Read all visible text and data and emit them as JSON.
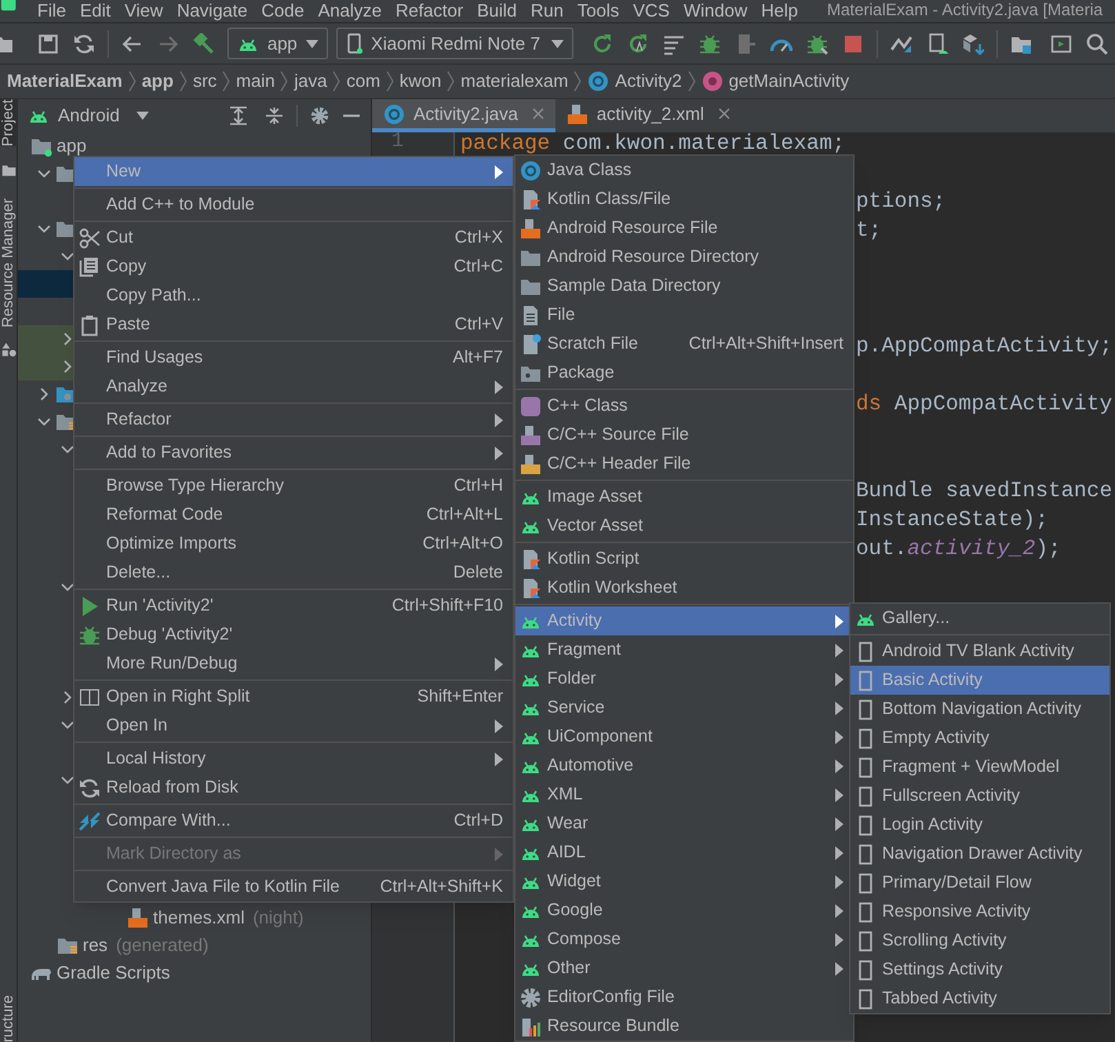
{
  "menu_bar": {
    "items": [
      "File",
      "Edit",
      "View",
      "Navigate",
      "Code",
      "Analyze",
      "Refactor",
      "Build",
      "Run",
      "Tools",
      "VCS",
      "Window",
      "Help"
    ],
    "title": "MaterialExam - Activity2.java [Materia"
  },
  "toolbar": {
    "config": "app",
    "device": "Xiaomi Redmi Note 7"
  },
  "breadcrumbs": [
    {
      "text": "MaterialExam",
      "kind": "project"
    },
    {
      "text": "app",
      "kind": "module"
    },
    {
      "text": "src",
      "kind": "dir"
    },
    {
      "text": "main",
      "kind": "dir"
    },
    {
      "text": "java",
      "kind": "dir"
    },
    {
      "text": "com",
      "kind": "dir"
    },
    {
      "text": "kwon",
      "kind": "dir"
    },
    {
      "text": "materialexam",
      "kind": "dir"
    },
    {
      "text": "Activity2",
      "kind": "class"
    },
    {
      "text": "getMainActivity",
      "kind": "method"
    }
  ],
  "side_tabs": [
    {
      "label": "Project",
      "selected": true
    },
    {
      "label": "Resource Manager",
      "selected": false
    },
    {
      "label": "ructure",
      "selected": false
    }
  ],
  "project_panel": {
    "view": "Android"
  },
  "project_tree": [
    {
      "label": "app",
      "kind": "module",
      "selected": false,
      "highlighted": false,
      "children": [
        {
          "kind": "folder",
          "expanded": true,
          "selected": false,
          "highlighted": false,
          "children": [
            {
              "selected": false,
              "highlighted": false
            }
          ]
        },
        {
          "kind": "folder",
          "expanded": true,
          "selected": false,
          "highlighted": false,
          "children": [
            {
              "expanded": true,
              "selected": false,
              "highlighted": false,
              "children": [
                {
                  "selected": true,
                  "highlighted": false
                },
                {
                  "selected": false,
                  "highlighted": false
                }
              ]
            },
            {
              "expanded": false,
              "selected": false,
              "highlighted": true
            },
            {
              "expanded": false,
              "selected": false,
              "highlighted": true
            }
          ]
        },
        {
          "kind": "gradle-folder",
          "expanded": false,
          "selected": false,
          "highlighted": false
        },
        {
          "kind": "res-folder",
          "expanded": true,
          "selected": false,
          "highlighted": false,
          "children": [
            {
              "expanded": true,
              "selected": false,
              "highlighted": false,
              "children": [
                {
                  "selected": false,
                  "highlighted": false
                },
                {
                  "selected": false,
                  "highlighted": false
                },
                {
                  "selected": false,
                  "highlighted": false
                },
                {
                  "selected": false,
                  "highlighted": false
                }
              ]
            },
            {
              "expanded": true,
              "selected": false,
              "highlighted": false,
              "children": [
                {
                  "selected": false,
                  "highlighted": false
                },
                {
                  "selected": false,
                  "highlighted": false
                },
                {
                  "selected": false,
                  "highlighted": false
                }
              ]
            },
            {
              "expanded": false,
              "selected": false,
              "highlighted": false
            },
            {
              "expanded": true,
              "selected": false,
              "highlighted": false,
              "children": [
                {
                  "selected": false,
                  "highlighted": false
                }
              ]
            },
            {
              "expanded": true,
              "selected": false,
              "highlighted": false,
              "children": [
                {
                  "selected": false,
                  "highlighted": false
                },
                {
                  "selected": false,
                  "highlighted": false
                },
                {
                  "selected": false,
                  "highlighted": false,
                  "children": [
                    {
                      "selected": false,
                      "highlighted": false
                    },
                    {
                      "label": "themes.xml",
                      "note": "(night)",
                      "kind": "xml-file",
                      "selected": false,
                      "highlighted": false
                    }
                  ]
                }
              ]
            }
          ]
        },
        {
          "label": "res",
          "note": "(generated)",
          "kind": "res-folder",
          "selected": false,
          "highlighted": false
        }
      ]
    },
    {
      "label": "Gradle Scripts",
      "kind": "gradle",
      "selected": false,
      "highlighted": false
    }
  ],
  "tabs": [
    {
      "label": "Activity2.java",
      "kind": "java",
      "selected": true
    },
    {
      "label": "activity_2.xml",
      "kind": "xml",
      "selected": false
    }
  ],
  "editor": {
    "lines": [
      {
        "number": "1",
        "kind": "line",
        "segments": [
          {
            "text": "package",
            "kind": "keyword"
          },
          {
            "text": " com.kwon.materialexam;",
            "kind": "plain"
          }
        ]
      },
      {
        "kind": "tail",
        "segments": [
          {
            "text": "ptions;",
            "kind": "plain"
          }
        ]
      },
      {
        "kind": "tail",
        "segments": [
          {
            "text": "t;",
            "kind": "plain"
          }
        ]
      },
      {
        "kind": "tail",
        "segments": [
          {
            "text": "p.AppCompatActivity;",
            "kind": "plain"
          }
        ]
      },
      {
        "kind": "tail",
        "segments": [
          {
            "text": "ds",
            "kind": "keyword"
          },
          {
            "text": " AppCompatActivity",
            "kind": "plain"
          }
        ]
      },
      {
        "kind": "tail",
        "segments": [
          {
            "text": "Bundle savedInstance",
            "kind": "plain"
          }
        ]
      },
      {
        "kind": "tail",
        "segments": [
          {
            "text": "InstanceState);",
            "kind": "plain"
          }
        ]
      },
      {
        "kind": "tail",
        "segments": [
          {
            "text": "out.",
            "kind": "plain"
          },
          {
            "text": "activity_2",
            "kind": "field"
          },
          {
            "text": ");",
            "kind": "plain"
          }
        ]
      }
    ]
  },
  "main_menu": {
    "groups": [
      [
        {
          "label": "New",
          "kind": "plain",
          "has_submenu": true,
          "selected": true,
          "disabled": false
        }
      ],
      [
        {
          "label": "Add C++ to Module",
          "kind": "plain",
          "has_submenu": false,
          "selected": false,
          "disabled": false
        }
      ],
      [
        {
          "label": "Cut",
          "kind": "scissors",
          "shortcut": "Ctrl+X",
          "has_submenu": false,
          "selected": false,
          "disabled": false
        },
        {
          "label": "Copy",
          "kind": "copy",
          "shortcut": "Ctrl+C",
          "has_submenu": false,
          "selected": false,
          "disabled": false
        },
        {
          "label": "Copy Path...",
          "kind": "plain",
          "has_submenu": false,
          "selected": false,
          "disabled": false
        },
        {
          "label": "Paste",
          "kind": "paste",
          "shortcut": "Ctrl+V",
          "has_submenu": false,
          "selected": false,
          "disabled": false
        }
      ],
      [
        {
          "label": "Find Usages",
          "kind": "plain",
          "shortcut": "Alt+F7",
          "has_submenu": false,
          "selected": false,
          "disabled": false
        },
        {
          "label": "Analyze",
          "kind": "plain",
          "has_submenu": true,
          "selected": false,
          "disabled": false
        }
      ],
      [
        {
          "label": "Refactor",
          "kind": "plain",
          "has_submenu": true,
          "selected": false,
          "disabled": false
        }
      ],
      [
        {
          "label": "Add to Favorites",
          "kind": "plain",
          "has_submenu": true,
          "selected": false,
          "disabled": false
        }
      ],
      [
        {
          "label": "Browse Type Hierarchy",
          "kind": "plain",
          "shortcut": "Ctrl+H",
          "has_submenu": false,
          "selected": false,
          "disabled": false
        },
        {
          "label": "Reformat Code",
          "kind": "plain",
          "shortcut": "Ctrl+Alt+L",
          "has_submenu": false,
          "selected": false,
          "disabled": false
        },
        {
          "label": "Optimize Imports",
          "kind": "plain",
          "shortcut": "Ctrl+Alt+O",
          "has_submenu": false,
          "selected": false,
          "disabled": false
        },
        {
          "label": "Delete...",
          "kind": "plain",
          "shortcut": "Delete",
          "has_submenu": false,
          "selected": false,
          "disabled": false
        }
      ],
      [
        {
          "label": "Run 'Activity2'",
          "kind": "run",
          "shortcut": "Ctrl+Shift+F10",
          "has_submenu": false,
          "selected": false,
          "disabled": false
        },
        {
          "label": "Debug 'Activity2'",
          "kind": "debug",
          "has_submenu": false,
          "selected": false,
          "disabled": false
        },
        {
          "label": "More Run/Debug",
          "kind": "plain",
          "has_submenu": true,
          "selected": false,
          "disabled": false
        }
      ],
      [
        {
          "label": "Open in Right Split",
          "kind": "split",
          "shortcut": "Shift+Enter",
          "has_submenu": false,
          "selected": false,
          "disabled": false
        },
        {
          "label": "Open In",
          "kind": "plain",
          "has_submenu": true,
          "selected": false,
          "disabled": false
        }
      ],
      [
        {
          "label": "Local History",
          "kind": "plain",
          "has_submenu": true,
          "selected": false,
          "disabled": false
        },
        {
          "label": "Reload from Disk",
          "kind": "reload",
          "has_submenu": false,
          "selected": false,
          "disabled": false
        }
      ],
      [
        {
          "label": "Compare With...",
          "kind": "compare",
          "shortcut": "Ctrl+D",
          "has_submenu": false,
          "selected": false,
          "disabled": false
        }
      ],
      [
        {
          "label": "Mark Directory as",
          "kind": "plain",
          "has_submenu": true,
          "selected": false,
          "disabled": true
        }
      ],
      [
        {
          "label": "Convert Java File to Kotlin File",
          "kind": "plain",
          "shortcut": "Ctrl+Alt+Shift+K",
          "has_submenu": false,
          "selected": false,
          "disabled": false
        }
      ]
    ]
  },
  "new_menu": {
    "groups": [
      [
        {
          "label": "Java Class",
          "kind": "java-class",
          "has_submenu": false,
          "selected": false
        },
        {
          "label": "Kotlin Class/File",
          "kind": "kotlin",
          "has_submenu": false,
          "selected": false
        },
        {
          "label": "Android Resource File",
          "kind": "xml-file",
          "has_submenu": false,
          "selected": false
        },
        {
          "label": "Android Resource Directory",
          "kind": "folder",
          "has_submenu": false,
          "selected": false
        },
        {
          "label": "Sample Data Directory",
          "kind": "folder",
          "has_submenu": false,
          "selected": false
        },
        {
          "label": "File",
          "kind": "file",
          "has_submenu": false,
          "selected": false
        },
        {
          "label": "Scratch File",
          "kind": "scratch",
          "shortcut": "Ctrl+Alt+Shift+Insert",
          "has_submenu": false,
          "selected": false
        },
        {
          "label": "Package",
          "kind": "package",
          "has_submenu": false,
          "selected": false
        }
      ],
      [
        {
          "label": "C++ Class",
          "kind": "cpp-class",
          "has_submenu": false,
          "selected": false
        },
        {
          "label": "C/C++ Source File",
          "kind": "cpp-file",
          "has_submenu": false,
          "selected": false
        },
        {
          "label": "C/C++ Header File",
          "kind": "header-file",
          "has_submenu": false,
          "selected": false
        }
      ],
      [
        {
          "label": "Image Asset",
          "kind": "android",
          "has_submenu": false,
          "selected": false
        },
        {
          "label": "Vector Asset",
          "kind": "android",
          "has_submenu": false,
          "selected": false
        }
      ],
      [
        {
          "label": "Kotlin Script",
          "kind": "kotlin",
          "has_submenu": false,
          "selected": false
        },
        {
          "label": "Kotlin Worksheet",
          "kind": "kotlin",
          "has_submenu": false,
          "selected": false
        }
      ],
      [
        {
          "label": "Activity",
          "kind": "android",
          "has_submenu": true,
          "selected": true
        },
        {
          "label": "Fragment",
          "kind": "android",
          "has_submenu": true,
          "selected": false
        },
        {
          "label": "Folder",
          "kind": "android",
          "has_submenu": true,
          "selected": false
        },
        {
          "label": "Service",
          "kind": "android",
          "has_submenu": true,
          "selected": false
        },
        {
          "label": "UiComponent",
          "kind": "android",
          "has_submenu": true,
          "selected": false
        },
        {
          "label": "Automotive",
          "kind": "android",
          "has_submenu": true,
          "selected": false
        },
        {
          "label": "XML",
          "kind": "android",
          "has_submenu": true,
          "selected": false
        },
        {
          "label": "Wear",
          "kind": "android",
          "has_submenu": true,
          "selected": false
        },
        {
          "label": "AIDL",
          "kind": "android",
          "has_submenu": true,
          "selected": false
        },
        {
          "label": "Widget",
          "kind": "android",
          "has_submenu": true,
          "selected": false
        },
        {
          "label": "Google",
          "kind": "android",
          "has_submenu": true,
          "selected": false
        },
        {
          "label": "Compose",
          "kind": "android",
          "has_submenu": true,
          "selected": false
        },
        {
          "label": "Other",
          "kind": "android",
          "has_submenu": true,
          "selected": false
        },
        {
          "label": "EditorConfig File",
          "kind": "gear",
          "has_submenu": false,
          "selected": false
        },
        {
          "label": "Resource Bundle",
          "kind": "bundle",
          "has_submenu": false,
          "selected": false
        }
      ]
    ]
  },
  "activity_menu": {
    "groups": [
      [
        {
          "label": "Gallery...",
          "kind": "android",
          "selected": false
        }
      ],
      [
        {
          "label": "Android TV Blank Activity",
          "kind": "activity",
          "selected": false
        },
        {
          "label": "Basic Activity",
          "kind": "activity",
          "selected": true
        },
        {
          "label": "Bottom Navigation Activity",
          "kind": "activity",
          "selected": false
        },
        {
          "label": "Empty Activity",
          "kind": "activity",
          "selected": false
        },
        {
          "label": "Fragment + ViewModel",
          "kind": "activity",
          "selected": false
        },
        {
          "label": "Fullscreen Activity",
          "kind": "activity",
          "selected": false
        },
        {
          "label": "Login Activity",
          "kind": "activity",
          "selected": false
        },
        {
          "label": "Navigation Drawer Activity",
          "kind": "activity",
          "selected": false
        },
        {
          "label": "Primary/Detail Flow",
          "kind": "activity",
          "selected": false
        },
        {
          "label": "Responsive Activity",
          "kind": "activity",
          "selected": false
        },
        {
          "label": "Scrolling Activity",
          "kind": "activity",
          "selected": false
        },
        {
          "label": "Settings Activity",
          "kind": "activity",
          "selected": false
        },
        {
          "label": "Tabbed Activity",
          "kind": "activity",
          "selected": false
        }
      ]
    ]
  }
}
